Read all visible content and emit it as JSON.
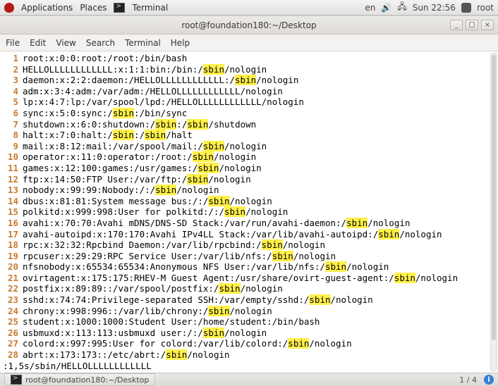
{
  "panel": {
    "applications": "Applications",
    "places": "Places",
    "terminal": "Terminal",
    "lang": "en",
    "clock": "Sun 22:56",
    "user": "root"
  },
  "window": {
    "title": "root@foundation180:~/Desktop",
    "min": "_",
    "max": "□",
    "close": "×"
  },
  "menubar": {
    "file": "File",
    "edit": "Edit",
    "view": "View",
    "search": "Search",
    "terminal": "Terminal",
    "help": "Help"
  },
  "highlight_word": "sbin",
  "lines": [
    {
      "n": 1,
      "segs": [
        {
          "t": "root:x:0:0:root:/root:/bin/bash"
        }
      ]
    },
    {
      "n": 2,
      "segs": [
        {
          "t": "HELLOLLLLLLLLLLLL:x:1:1:bin:/bin:/"
        },
        {
          "t": "sbin",
          "h": true
        },
        {
          "t": "/nologin"
        }
      ]
    },
    {
      "n": 3,
      "segs": [
        {
          "t": "daemon:x:2:2:daemon:/HELLOLLLLLLLLLLLL:/"
        },
        {
          "t": "sbin",
          "h": true
        },
        {
          "t": "/nologin"
        }
      ]
    },
    {
      "n": 4,
      "segs": [
        {
          "t": "adm:x:3:4:adm:/var/adm:/HELLOLLLLLLLLLLLL/nologin"
        }
      ]
    },
    {
      "n": 5,
      "segs": [
        {
          "t": "lp:x:4:7:lp:/var/spool/lpd:/HELLOLLLLLLLLLLLL/nologin"
        }
      ]
    },
    {
      "n": 6,
      "segs": [
        {
          "t": "sync:x:5:0:sync:/"
        },
        {
          "t": "sbin",
          "h": true
        },
        {
          "t": ":/bin/sync"
        }
      ]
    },
    {
      "n": 7,
      "segs": [
        {
          "t": "shutdown:x:6:0:shutdown:/"
        },
        {
          "t": "sbin",
          "h": true
        },
        {
          "t": ":/"
        },
        {
          "t": "sbin",
          "h": true
        },
        {
          "t": "/shutdown"
        }
      ]
    },
    {
      "n": 8,
      "segs": [
        {
          "t": "halt:x:7:0:halt:/"
        },
        {
          "t": "sbin",
          "h": true
        },
        {
          "t": ":/"
        },
        {
          "t": "sbin",
          "h": true
        },
        {
          "t": "/halt"
        }
      ]
    },
    {
      "n": 9,
      "segs": [
        {
          "t": "mail:x:8:12:mail:/var/spool/mail:/"
        },
        {
          "t": "sbin",
          "h": true
        },
        {
          "t": "/nologin"
        }
      ]
    },
    {
      "n": 10,
      "segs": [
        {
          "t": "operator:x:11:0:operator:/root:/"
        },
        {
          "t": "sbin",
          "h": true
        },
        {
          "t": "/nologin"
        }
      ]
    },
    {
      "n": 11,
      "segs": [
        {
          "t": "games:x:12:100:games:/usr/games:/"
        },
        {
          "t": "sbin",
          "h": true
        },
        {
          "t": "/nologin"
        }
      ]
    },
    {
      "n": 12,
      "segs": [
        {
          "t": "ftp:x:14:50:FTP User:/var/ftp:/"
        },
        {
          "t": "sbin",
          "h": true
        },
        {
          "t": "/nologin"
        }
      ]
    },
    {
      "n": 13,
      "segs": [
        {
          "t": "nobody:x:99:99:Nobody:/:/"
        },
        {
          "t": "sbin",
          "h": true
        },
        {
          "t": "/nologin"
        }
      ]
    },
    {
      "n": 14,
      "segs": [
        {
          "t": "dbus:x:81:81:System message bus:/:/"
        },
        {
          "t": "sbin",
          "h": true
        },
        {
          "t": "/nologin"
        }
      ]
    },
    {
      "n": 15,
      "segs": [
        {
          "t": "polkitd:x:999:998:User for polkitd:/:/"
        },
        {
          "t": "sbin",
          "h": true
        },
        {
          "t": "/nologin"
        }
      ]
    },
    {
      "n": 16,
      "segs": [
        {
          "t": "avahi:x:70:70:Avahi mDNS/DNS-SD Stack:/var/run/avahi-daemon:/"
        },
        {
          "t": "sbin",
          "h": true
        },
        {
          "t": "/nologin"
        }
      ]
    },
    {
      "n": 17,
      "segs": [
        {
          "t": "avahi-autoipd:x:170:170:Avahi IPv4LL Stack:/var/lib/avahi-autoipd:/"
        },
        {
          "t": "sbin",
          "h": true
        },
        {
          "t": "/nologin"
        }
      ]
    },
    {
      "n": 18,
      "segs": [
        {
          "t": "rpc:x:32:32:Rpcbind Daemon:/var/lib/rpcbind:/"
        },
        {
          "t": "sbin",
          "h": true
        },
        {
          "t": "/nologin"
        }
      ]
    },
    {
      "n": 19,
      "segs": [
        {
          "t": "rpcuser:x:29:29:RPC Service User:/var/lib/nfs:/"
        },
        {
          "t": "sbin",
          "h": true
        },
        {
          "t": "/nologin"
        }
      ]
    },
    {
      "n": 20,
      "segs": [
        {
          "t": "nfsnobody:x:65534:65534:Anonymous NFS User:/var/lib/nfs:/"
        },
        {
          "t": "sbin",
          "h": true
        },
        {
          "t": "/nologin"
        }
      ]
    },
    {
      "n": 21,
      "segs": [
        {
          "t": "ovirtagent:x:175:175:RHEV-M Guest Agent:/usr/share/ovirt-guest-agent:/"
        },
        {
          "t": "sbin",
          "h": true
        },
        {
          "t": "/nologin"
        }
      ]
    },
    {
      "n": 22,
      "segs": [
        {
          "t": "postfix:x:89:89::/var/spool/postfix:/"
        },
        {
          "t": "sbin",
          "h": true
        },
        {
          "t": "/nologin"
        }
      ]
    },
    {
      "n": 23,
      "segs": [
        {
          "t": "sshd:x:74:74:Privilege-separated SSH:/var/empty/sshd:/"
        },
        {
          "t": "sbin",
          "h": true
        },
        {
          "t": "/nologin"
        }
      ]
    },
    {
      "n": 24,
      "segs": [
        {
          "t": "chrony:x:998:996::/var/lib/chrony:/"
        },
        {
          "t": "sbin",
          "h": true
        },
        {
          "t": "/nologin"
        }
      ]
    },
    {
      "n": 25,
      "segs": [
        {
          "t": "student:x:1000:1000:Student User:/home/student:/bin/bash"
        }
      ]
    },
    {
      "n": 26,
      "segs": [
        {
          "t": "usbmuxd:x:113:113:usbmuxd user:/:/"
        },
        {
          "t": "sbin",
          "h": true
        },
        {
          "t": "/nologin"
        }
      ]
    },
    {
      "n": 27,
      "segs": [
        {
          "t": "colord:x:997:995:User for colord:/var/lib/colord:/"
        },
        {
          "t": "sbin",
          "h": true
        },
        {
          "t": "/nologin"
        }
      ]
    },
    {
      "n": 28,
      "segs": [
        {
          "t": "abrt:x:173:173::/etc/abrt:/"
        },
        {
          "t": "sbin",
          "h": true
        },
        {
          "t": "/nologin"
        }
      ]
    }
  ],
  "command_line": ":1,5s/sbin/HELLOLLLLLLLLLLLL",
  "taskbar": {
    "task_label": "root@foundation180:~/Desktop",
    "pager": "1 / 4",
    "info": "i"
  }
}
